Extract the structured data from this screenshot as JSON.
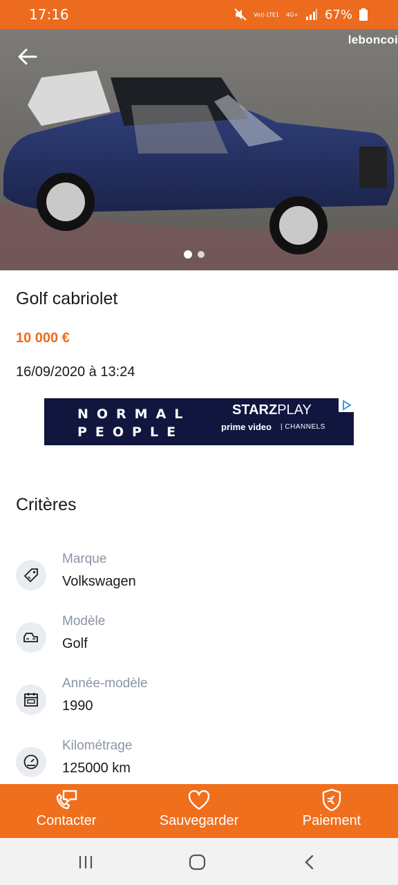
{
  "status_bar": {
    "time": "17:16",
    "net_top": "Vo)) LTE1",
    "net_mid": "4G+",
    "battery": "67%"
  },
  "gallery": {
    "brand": "leboncoi",
    "total_images": 2,
    "current_index": 1
  },
  "listing": {
    "title": "Golf cabriolet",
    "price": "10 000 €",
    "date": "16/09/2020 à 13:24"
  },
  "ad": {
    "line1": "NORMAL",
    "line2": "PEOPLE",
    "starz": "STARZ",
    "play": "PLAY",
    "prime": "prime video",
    "channels": "CHANNELS"
  },
  "criteria": {
    "heading": "Critères",
    "items": [
      {
        "label": "Marque",
        "value": "Volkswagen",
        "icon": "tag-icon"
      },
      {
        "label": "Modèle",
        "value": "Golf",
        "icon": "car-icon"
      },
      {
        "label": "Année-modèle",
        "value": "1990",
        "icon": "calendar-icon"
      },
      {
        "label": "Kilométrage",
        "value": "125000 km",
        "icon": "speedometer-icon"
      }
    ]
  },
  "actions": {
    "contact": "Contacter",
    "save": "Sauvegarder",
    "pay": "Paiement"
  },
  "colors": {
    "accent": "#ec6b1e",
    "action_bar": "#f06f1d"
  }
}
